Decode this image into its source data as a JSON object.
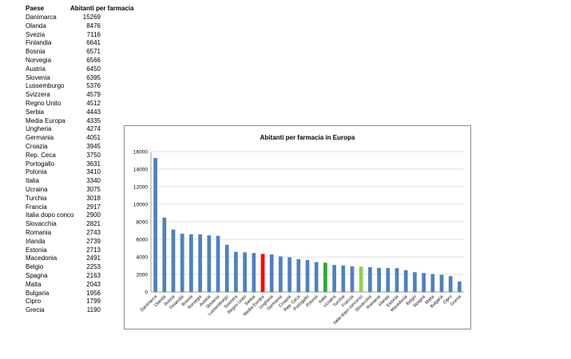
{
  "table": {
    "headers": [
      "Paese",
      "Abitanti per farmacia"
    ],
    "rows": [
      [
        "Danimarca",
        "15269"
      ],
      [
        "Olanda",
        "8476"
      ],
      [
        "Svezia",
        "7116"
      ],
      [
        "Finlandia",
        "6641"
      ],
      [
        "Bosnia",
        "6571"
      ],
      [
        "Norvegia",
        "6566"
      ],
      [
        "Austria",
        "6450"
      ],
      [
        "Slovenia",
        "6395"
      ],
      [
        "Lussemburgo",
        "5376"
      ],
      [
        "Svizzera",
        "4579"
      ],
      [
        "Regno Unito",
        "4512"
      ],
      [
        "Serbia",
        "4443"
      ],
      [
        "Media Europa",
        "4335"
      ],
      [
        "Ungheria",
        "4274"
      ],
      [
        "Germania",
        "4051"
      ],
      [
        "Croazia",
        "3945"
      ],
      [
        "Rep. Ceca",
        "3750"
      ],
      [
        "Portogallo",
        "3631"
      ],
      [
        "Polonia",
        "3410"
      ],
      [
        "Italia",
        "3340"
      ],
      [
        "Ucraina",
        "3075"
      ],
      [
        "Turchia",
        "3018"
      ],
      [
        "Francia",
        "2917"
      ],
      [
        "Italia dopo conco",
        "2900"
      ],
      [
        "Slovacchia",
        "2821"
      ],
      [
        "Romania",
        "2743"
      ],
      [
        "Irlanda",
        "2739"
      ],
      [
        "Estonia",
        "2713"
      ],
      [
        "Macedonia",
        "2491"
      ],
      [
        "Belgio",
        "2253"
      ],
      [
        "Spagna",
        "2163"
      ],
      [
        "Malta",
        "2043"
      ],
      [
        "Bulgaria",
        "1956"
      ],
      [
        "Cipro",
        "1799"
      ],
      [
        "Grecia",
        "1190"
      ]
    ]
  },
  "chart_data": {
    "type": "bar",
    "title": "Abitanti per farmacia in Europa",
    "xlabel": "",
    "ylabel": "",
    "ylim": [
      0,
      16000
    ],
    "yticks": [
      0,
      2000,
      4000,
      6000,
      8000,
      10000,
      12000,
      14000,
      16000
    ],
    "grid": true,
    "legend": "none",
    "categories": [
      "Danimarca",
      "Olanda",
      "Svezia",
      "Finlandia",
      "Bosnia",
      "Norvegia",
      "Austria",
      "Slovenia",
      "Lussemburgo",
      "Svizzera",
      "Regno Unito",
      "Serbia",
      "Media Europa",
      "Ungheria",
      "Germania",
      "Croazia",
      "Rep. Ceca",
      "Portogallo",
      "Polonia",
      "Italia",
      "Ucraina",
      "Turchia",
      "Francia",
      "Italia dopo concorso",
      "Slovacchia",
      "Romania",
      "Irlanda",
      "Estonia",
      "Macedonia",
      "Belgio",
      "Spagna",
      "Malta",
      "Bulgaria",
      "Cipro",
      "Grecia"
    ],
    "values": [
      15269,
      8476,
      7116,
      6641,
      6571,
      6566,
      6450,
      6395,
      5376,
      4579,
      4512,
      4443,
      4335,
      4274,
      4051,
      3945,
      3750,
      3631,
      3410,
      3340,
      3075,
      3018,
      2917,
      2900,
      2821,
      2743,
      2739,
      2713,
      2491,
      2253,
      2163,
      2043,
      1956,
      1799,
      1190
    ],
    "default_color": "#4f81bd",
    "highlight_colors": {
      "Media Europa": "#ff0000",
      "Italia": "#2ea836",
      "Italia dopo concorso": "#92d050"
    },
    "grid_color": "#d9d9d9",
    "axis_color": "#888888"
  }
}
